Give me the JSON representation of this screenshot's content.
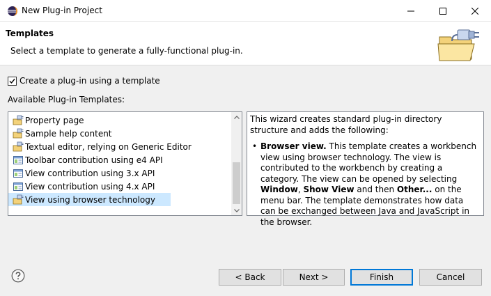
{
  "window": {
    "title": "New Plug-in Project"
  },
  "header": {
    "title": "Templates",
    "description": "Select a template to generate a fully-functional plug-in."
  },
  "options": {
    "use_template_label": "Create a plug-in using a template",
    "use_template_checked": true
  },
  "templates": {
    "section_label": "Available Plug-in Templates:",
    "items": [
      {
        "label": "Property page",
        "icon": "plugin-template-icon"
      },
      {
        "label": "Sample help content",
        "icon": "plugin-template-icon"
      },
      {
        "label": "Textual editor, relying on Generic Editor",
        "icon": "plugin-template-icon"
      },
      {
        "label": "Toolbar contribution using e4 API",
        "icon": "e4-template-icon"
      },
      {
        "label": "View contribution using 3.x API",
        "icon": "e4-template-icon"
      },
      {
        "label": "View contribution using 4.x API",
        "icon": "e4-template-icon"
      },
      {
        "label": "View using browser technology",
        "icon": "plugin-template-icon",
        "selected": true
      }
    ]
  },
  "description": {
    "intro": "This wizard creates standard plug-in directory structure and adds the following:",
    "item_title": "Browser view.",
    "item_text_1": " This template creates a workbench view using browser technology. The view is contributed to the workbench by creating a category. The view can be opened by selecting ",
    "bold_window": "Window",
    "comma": ", ",
    "bold_show_view": "Show View",
    "item_text_2": " and then ",
    "bold_other": "Other...",
    "item_text_3": " on the menu bar. The template demonstrates how data can be exchanged between Java and JavaScript in the browser."
  },
  "buttons": {
    "back": "< Back",
    "next": "Next >",
    "finish": "Finish",
    "cancel": "Cancel"
  }
}
